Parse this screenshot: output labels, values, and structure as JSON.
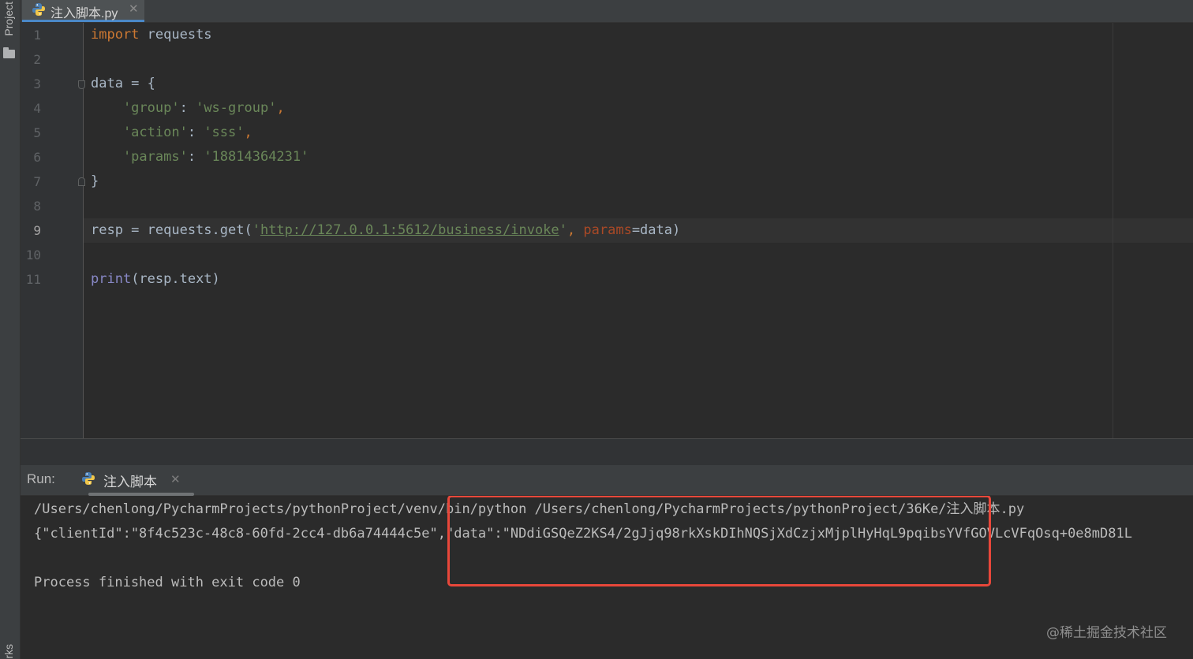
{
  "sidebar": {
    "project_label": "Project",
    "bottom_label": "rks"
  },
  "editor_tab": {
    "filename": "注入脚本.py",
    "close": "✕"
  },
  "editor": {
    "line_numbers": [
      "1",
      "2",
      "3",
      "4",
      "5",
      "6",
      "7",
      "8",
      "9",
      "10",
      "11"
    ],
    "current_line": 9,
    "code": {
      "l1_import": "import",
      "l1_module": " requests",
      "l3_text": "data = {",
      "l4_key": "    'group'",
      "l4_sep": ": ",
      "l4_val": "'ws-group'",
      "l4_comma": ",",
      "l5_key": "    'action'",
      "l5_sep": ": ",
      "l5_val": "'sss'",
      "l5_comma": ",",
      "l6_key": "    'params'",
      "l6_sep": ": ",
      "l6_val": "'18814364231'",
      "l7_text": "}",
      "l9_start": "resp = requests.get(",
      "l9_q1": "'",
      "l9_url": "http://127.0.0.1:5612/business/invoke",
      "l9_q2": "'",
      "l9_comma": ", ",
      "l9_param": "params",
      "l9_end": "=data)",
      "l11_builtin": "print",
      "l11_rest": "(resp.text)"
    }
  },
  "run_panel": {
    "label": "Run:",
    "tab_label": "注入脚本",
    "close": "✕",
    "output": [
      "/Users/chenlong/PycharmProjects/pythonProject/venv/bin/python /Users/chenlong/PycharmProjects/pythonProject/36Ke/注入脚本.py",
      "{\"clientId\":\"8f4c523c-48c8-60fd-2cc4-db6a74444c5e\",\"data\":\"NDdiGSQeZ2KS4/2gJjq98rkXskDIhNQSjXdCzjxMjplHyHqL9pqibsYVfGOVLcVFqOsq+0e8mD81L",
      "",
      "Process finished with exit code 0"
    ]
  },
  "watermark": "@稀土掘金技术社区",
  "colors": {
    "highlight_box": "#e8473a",
    "tab_accent": "#4a88c7",
    "keyword": "#cc7832",
    "string": "#6a8759",
    "builtin": "#8888c6",
    "param": "#aa4926"
  }
}
